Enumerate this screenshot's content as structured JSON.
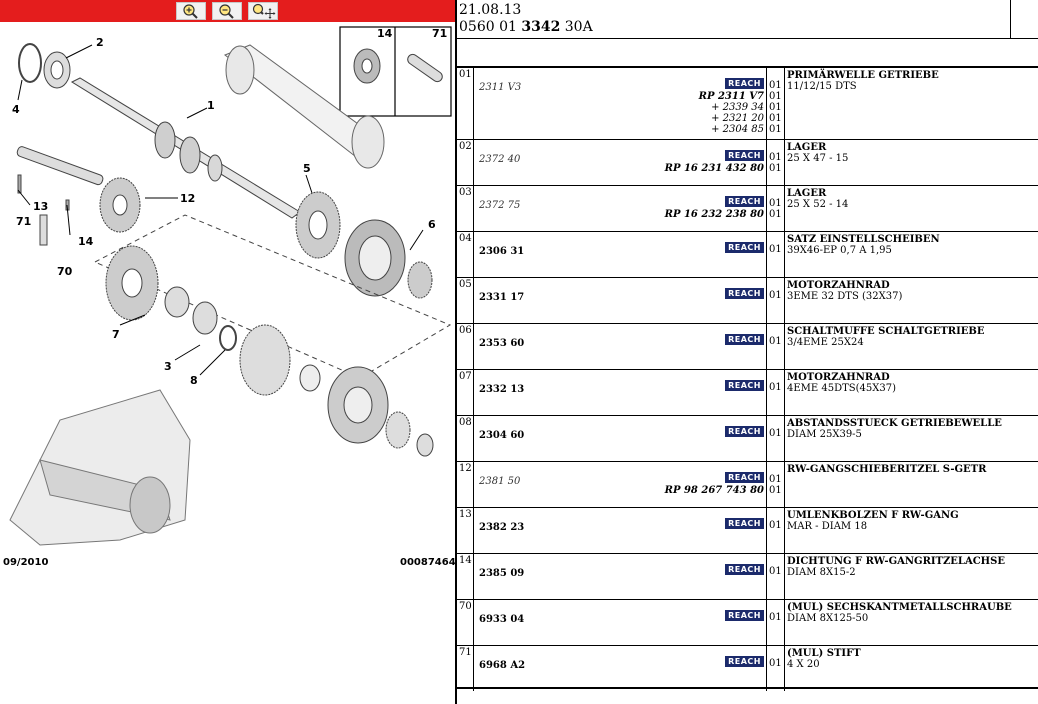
{
  "toolbar": {
    "buttons": [
      {
        "icon": "zoom-in-icon"
      },
      {
        "icon": "zoom-out-icon"
      },
      {
        "icon": "zoom-pan-icon"
      }
    ]
  },
  "diagram": {
    "callouts": [
      "1",
      "2",
      "4",
      "5",
      "12",
      "13",
      "71",
      "14",
      "70",
      "6",
      "7",
      "3",
      "8"
    ],
    "inset_labels": [
      "14",
      "71"
    ],
    "footer_date": "09/2010",
    "footer_code": "00087464"
  },
  "header": {
    "date": "21.08.13",
    "ref_prefix": "0560 01 ",
    "ref_bold": "3342",
    "ref_suffix": " 30A"
  },
  "parts": [
    {
      "pos": "01",
      "ref": "2311 V3",
      "ref_style": "old",
      "badge": "REACH",
      "subrefs": [
        {
          "text": "RP 2311 V7",
          "bold": true
        },
        {
          "text": "+ 2339 34",
          "bold": false
        },
        {
          "text": "+ 2321 20",
          "bold": false
        },
        {
          "text": "+ 2304 85",
          "bold": false
        }
      ],
      "qty": [
        "01",
        "01",
        "01",
        "01",
        "01"
      ],
      "title": "PRIMÄRWELLE GETRIEBE",
      "desc": "11/12/15 DTS"
    },
    {
      "pos": "02",
      "ref": "2372 40",
      "ref_style": "old",
      "badge": "REACH",
      "subrefs": [
        {
          "text": "RP 16 231 432 80",
          "bold": true
        }
      ],
      "qty": [
        "01",
        "01"
      ],
      "title": "LAGER",
      "desc": "25 X 47 - 15"
    },
    {
      "pos": "03",
      "ref": "2372 75",
      "ref_style": "old",
      "badge": "REACH",
      "subrefs": [
        {
          "text": "RP 16 232 238 80",
          "bold": true
        }
      ],
      "qty": [
        "01",
        "01"
      ],
      "title": "LAGER",
      "desc": "25 X 52 - 14"
    },
    {
      "pos": "04",
      "ref": "2306 31",
      "ref_style": "cur",
      "badge": "REACH",
      "subrefs": [],
      "qty": [
        "01"
      ],
      "title": "SATZ EINSTELLSCHEIBEN",
      "desc": "39X46-EP 0,7 A 1,95"
    },
    {
      "pos": "05",
      "ref": "2331 17",
      "ref_style": "cur",
      "badge": "REACH",
      "subrefs": [],
      "qty": [
        "01"
      ],
      "title": "MOTORZAHNRAD",
      "desc": "3EME 32 DTS (32X37)"
    },
    {
      "pos": "06",
      "ref": "2353 60",
      "ref_style": "cur",
      "badge": "REACH",
      "subrefs": [],
      "qty": [
        "01"
      ],
      "title": "SCHALTMUFFE SCHALTGETRIEBE",
      "desc": "3/4EME 25X24"
    },
    {
      "pos": "07",
      "ref": "2332 13",
      "ref_style": "cur",
      "badge": "REACH",
      "subrefs": [],
      "qty": [
        "01"
      ],
      "title": "MOTORZAHNRAD",
      "desc": "4EME 45DTS(45X37)"
    },
    {
      "pos": "08",
      "ref": "2304 60",
      "ref_style": "cur",
      "badge": "REACH",
      "subrefs": [],
      "qty": [
        "01"
      ],
      "title": "ABSTANDSSTUECK GETRIEBEWELLE",
      "desc": "DIAM 25X39-5"
    },
    {
      "pos": "12",
      "ref": "2381 50",
      "ref_style": "old",
      "badge": "REACH",
      "subrefs": [
        {
          "text": "RP 98 267 743 80",
          "bold": true
        }
      ],
      "qty": [
        "01",
        "01"
      ],
      "title": "RW-GANGSCHIEBERITZEL S-GETR",
      "desc": ""
    },
    {
      "pos": "13",
      "ref": "2382 23",
      "ref_style": "cur",
      "badge": "REACH",
      "subrefs": [],
      "qty": [
        "01"
      ],
      "title": "UMLENKBOLZEN F RW-GANG",
      "desc": "MAR - DIAM 18"
    },
    {
      "pos": "14",
      "ref": "2385 09",
      "ref_style": "cur",
      "badge": "REACH",
      "subrefs": [],
      "qty": [
        "01"
      ],
      "title": "DICHTUNG F RW-GANGRITZELACHSE",
      "desc": "DIAM 8X15-2"
    },
    {
      "pos": "70",
      "ref": "6933 04",
      "ref_style": "cur",
      "badge": "REACH",
      "subrefs": [],
      "qty": [
        "01"
      ],
      "title": "(MUL) SECHSKANTMETALLSCHRAUBE",
      "desc": "DIAM 8X125-50"
    },
    {
      "pos": "71",
      "ref": "6968 A2",
      "ref_style": "cur",
      "badge": "REACH",
      "subrefs": [],
      "qty": [
        "01"
      ],
      "title": "(MUL) STIFT",
      "desc": "4 X 20"
    }
  ],
  "colors": {
    "toolbar": "#e41d1d",
    "badge": "#1b2a6b"
  }
}
